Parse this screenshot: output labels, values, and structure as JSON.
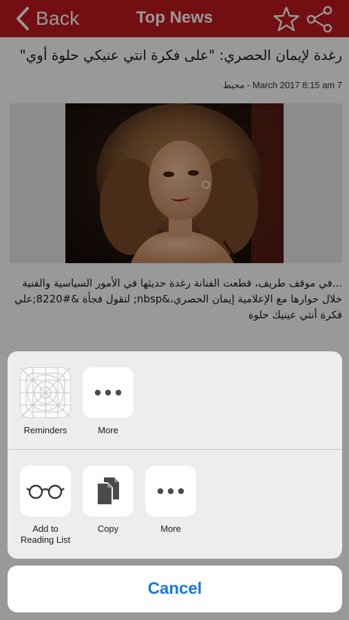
{
  "navbar": {
    "back_label": "Back",
    "title": "Top News",
    "accent": "#c0191f"
  },
  "article": {
    "headline": "رغدة لإيمان الحصري: \"على فكرة انتي عنيكي حلوة أوي\"",
    "source": "محيط",
    "date": "7 March 2017 8:15 am",
    "meta_line": "7 March 2017 8:15 am - محيط",
    "body": "...في موقف طريف، قطعت الفنانة رغدة حديثها في الأمور السياسية والفنية خلال حوارها مع الإعلامية إيمان الحصري،&nbsp; لتقول فجأة &#8220;علي فكرة أنتي عينيك حلوة"
  },
  "share_sheet": {
    "row1": [
      {
        "label": "Reminders",
        "icon": "reminders-app-icon"
      },
      {
        "label": "More",
        "icon": "more-dots-icon"
      }
    ],
    "row2": [
      {
        "label_line1": "Add to",
        "label_line2": "Reading List",
        "icon": "glasses-icon"
      },
      {
        "label": "Copy",
        "icon": "copy-icon"
      },
      {
        "label": "More",
        "icon": "more-dots-icon"
      }
    ],
    "cancel_label": "Cancel",
    "cancel_color": "#1478e0"
  }
}
